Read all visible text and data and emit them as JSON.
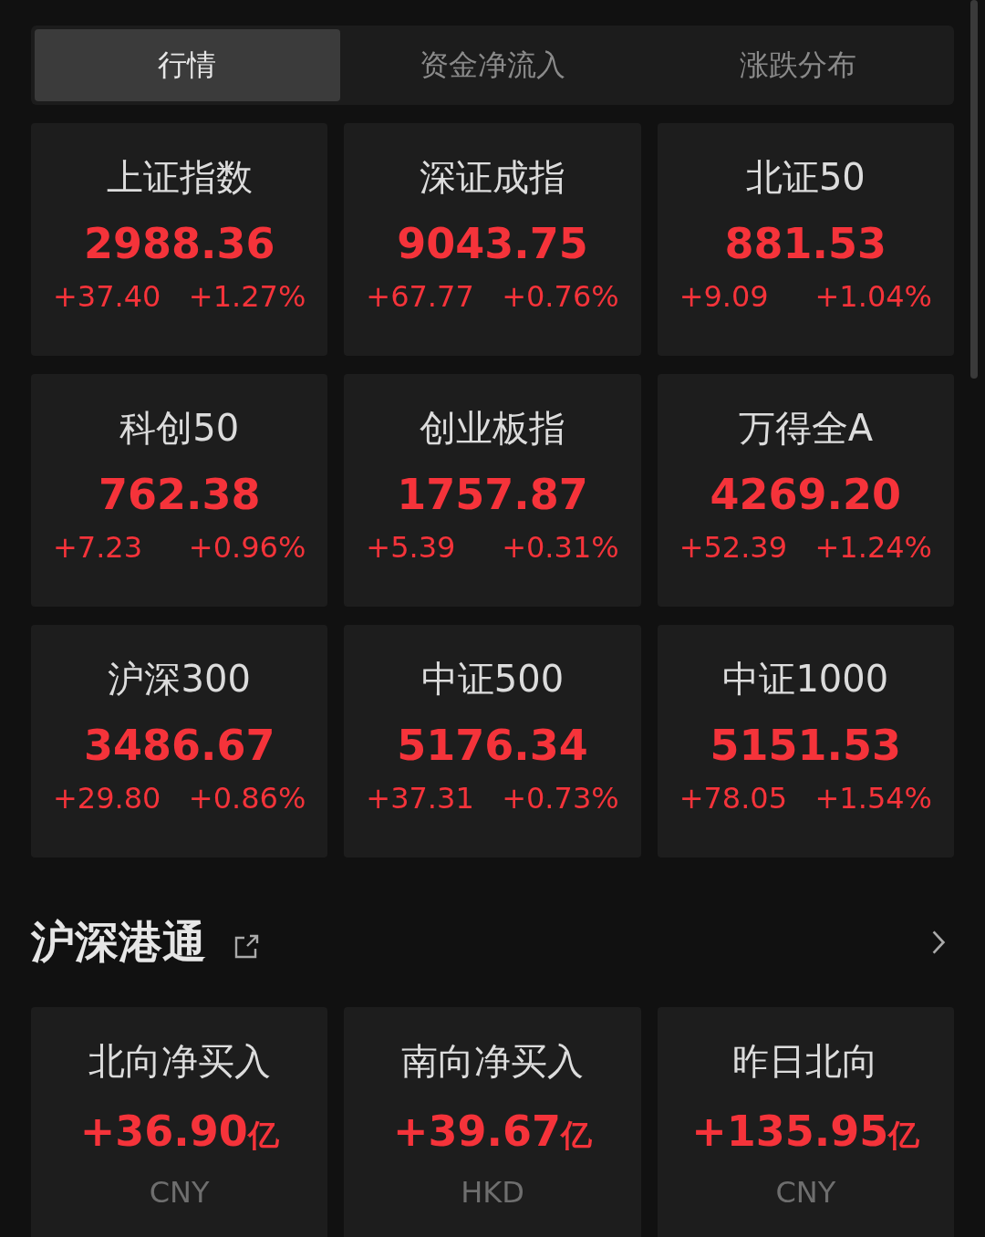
{
  "tabs": [
    {
      "label": "行情",
      "selected": true
    },
    {
      "label": "资金净流入",
      "selected": false
    },
    {
      "label": "涨跌分布",
      "selected": false
    }
  ],
  "indices": [
    {
      "name": "上证指数",
      "value": "2988.36",
      "change": "+37.40",
      "percent": "+1.27%"
    },
    {
      "name": "深证成指",
      "value": "9043.75",
      "change": "+67.77",
      "percent": "+0.76%"
    },
    {
      "name": "北证50",
      "value": "881.53",
      "change": "+9.09",
      "percent": "+1.04%"
    },
    {
      "name": "科创50",
      "value": "762.38",
      "change": "+7.23",
      "percent": "+0.96%"
    },
    {
      "name": "创业板指",
      "value": "1757.87",
      "change": "+5.39",
      "percent": "+0.31%"
    },
    {
      "name": "万得全A",
      "value": "4269.20",
      "change": "+52.39",
      "percent": "+1.24%"
    },
    {
      "name": "沪深300",
      "value": "3486.67",
      "change": "+29.80",
      "percent": "+0.86%"
    },
    {
      "name": "中证500",
      "value": "5176.34",
      "change": "+37.31",
      "percent": "+0.73%"
    },
    {
      "name": "中证1000",
      "value": "5151.53",
      "change": "+78.05",
      "percent": "+1.54%"
    }
  ],
  "connect": {
    "title": "沪深港通",
    "cards": [
      {
        "name": "北向净买入",
        "value": "+36.90",
        "unit": "亿",
        "currency": "CNY"
      },
      {
        "name": "南向净买入",
        "value": "+39.67",
        "unit": "亿",
        "currency": "HKD"
      },
      {
        "name": "昨日北向",
        "value": "+135.95",
        "unit": "亿",
        "currency": "CNY"
      }
    ]
  }
}
